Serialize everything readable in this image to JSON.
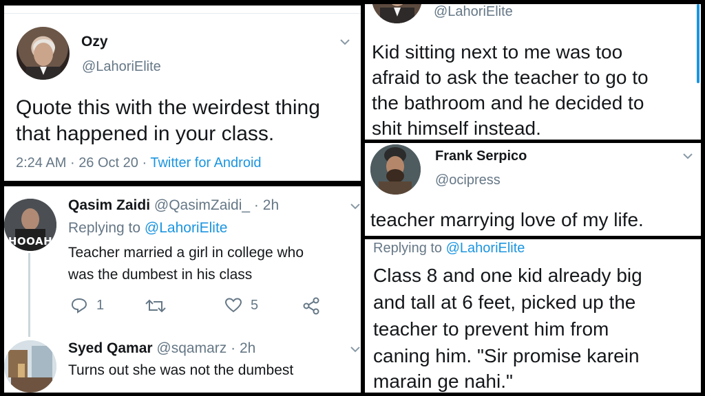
{
  "panel1": {
    "user_name": "Ozy",
    "handle": "@LahoriElite",
    "text_line1": "Quote this with the weirdest thing",
    "text_line2": "that happened in your class.",
    "time": "2:24 AM",
    "date": "26 Oct 20",
    "separator": "·",
    "source": "Twitter for Android"
  },
  "panel2": {
    "reply1": {
      "user_name": "Qasim Zaidi",
      "handle": "@QasimZaidi_",
      "dot": "·",
      "age": "2h",
      "replying_prefix": "Replying to",
      "replying_to": "@LahoriElite",
      "text_line1": "Teacher married a girl in college who",
      "text_line2": "was the dumbest in his class",
      "avatar_caption": "HOOAH",
      "reply_count": "1",
      "like_count": "5"
    },
    "reply2": {
      "user_name": "Syed Qamar",
      "handle": "@sqamarz",
      "dot": "·",
      "age": "2h",
      "text": "Turns out she was not the dumbest"
    }
  },
  "panel3": {
    "handle": "@LahoriElite",
    "text_line1": "Kid sitting next to me was too",
    "text_line2": "afraid to ask the teacher to go to",
    "text_line3": "the bathroom and he decided to",
    "text_line4": "shit himself instead."
  },
  "panel4": {
    "user_name": "Frank Serpico",
    "handle": "@ocipress",
    "text": "teacher marrying love of my life."
  },
  "panel5": {
    "replying_prefix": "Replying to",
    "replying_to": "@LahoriElite",
    "text_line1": "Class 8 and one kid already big",
    "text_line2": "and tall at 6 feet, picked up the",
    "text_line3": "teacher to prevent him from",
    "text_line4": "caning him. \"Sir promise karein",
    "text_line5": "marain ge nahi.\""
  },
  "colors": {
    "link": "#1b95e0",
    "muted": "#657786",
    "text": "#14171a",
    "background": "#000000"
  },
  "icons": [
    "chevron-down-icon",
    "reply-icon",
    "retweet-icon",
    "like-icon",
    "share-icon"
  ]
}
